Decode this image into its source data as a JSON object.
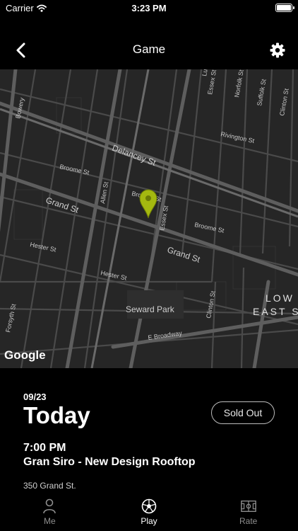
{
  "status_bar": {
    "carrier": "Carrier",
    "time": "3:23 PM"
  },
  "nav": {
    "title": "Game"
  },
  "map": {
    "streets": {
      "bowery": "Bowery",
      "delancey": "Delancey St",
      "broome_w": "Broome St",
      "broome_c": "Broome St",
      "broome_e": "Broome St",
      "grand_w": "Grand St",
      "grand_e": "Grand St",
      "allen": "Allen St",
      "essex_s": "Essex St",
      "essex_n": "Essex St",
      "norfolk": "Norfolk St",
      "suffolk": "Suffolk St",
      "clinton_n": "Clinton St",
      "clinton_s": "Clinton St",
      "rivington": "Rivington St",
      "hester_w": "Hester St",
      "hester_c": "Hester St",
      "forsyth": "Forsyth St",
      "e_broadway": "E Broadway",
      "ludlow": "Lu"
    },
    "places": {
      "seward_park": "Seward Park"
    },
    "area": {
      "line1": "LOW",
      "line2": "EAST S"
    },
    "attribution": "Google",
    "pin_color": "#a4b810"
  },
  "event": {
    "date": "09/23",
    "day": "Today",
    "status_button": "Sold Out",
    "time": "7:00 PM",
    "venue": "Gran Siro - New Design Rooftop",
    "address": "350 Grand St."
  },
  "tabs": [
    {
      "label": "Me",
      "icon": "person-icon",
      "active": false
    },
    {
      "label": "Play",
      "icon": "soccer-ball-icon",
      "active": true
    },
    {
      "label": "Rate",
      "icon": "field-icon",
      "active": false
    }
  ]
}
